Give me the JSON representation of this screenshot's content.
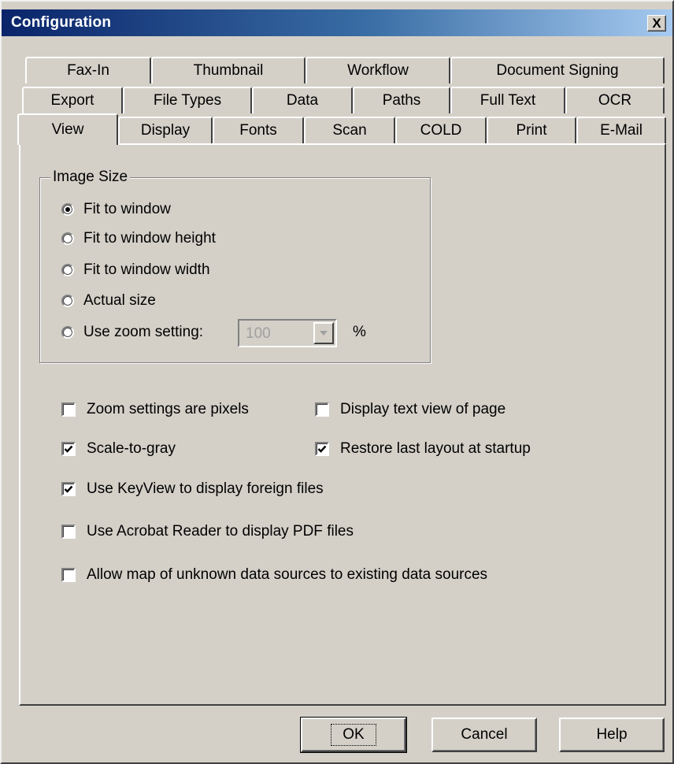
{
  "window": {
    "title": "Configuration",
    "close_symbol": "X"
  },
  "tabs": {
    "row1": [
      "Fax-In",
      "Thumbnail",
      "Workflow",
      "Document Signing"
    ],
    "row2": [
      "Export",
      "File Types",
      "Data",
      "Paths",
      "Full Text",
      "OCR"
    ],
    "row3": [
      "View",
      "Display",
      "Fonts",
      "Scan",
      "COLD",
      "Print",
      "E-Mail"
    ],
    "active": "View"
  },
  "image_size": {
    "legend": "Image Size",
    "options": [
      "Fit to window",
      "Fit to window height",
      "Fit to window width",
      "Actual size",
      "Use zoom setting:"
    ],
    "selected": "Fit to window",
    "zoom_value": "100",
    "percent_label": "%"
  },
  "checkboxes": {
    "zoom_pixels": {
      "label": "Zoom settings are pixels",
      "checked": false
    },
    "display_text_view": {
      "label": "Display text view of page",
      "checked": false
    },
    "scale_to_gray": {
      "label": "Scale-to-gray",
      "checked": true
    },
    "restore_layout": {
      "label": "Restore last layout at startup",
      "checked": true
    },
    "keyview": {
      "label": "Use KeyView to display foreign files",
      "checked": true
    },
    "acrobat": {
      "label": "Use Acrobat Reader to display PDF files",
      "checked": false
    },
    "map_unknown": {
      "label": "Allow map of unknown data sources to existing data sources",
      "checked": false
    }
  },
  "buttons": {
    "ok": "OK",
    "cancel": "Cancel",
    "help": "Help"
  }
}
